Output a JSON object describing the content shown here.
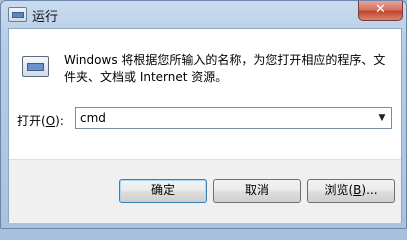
{
  "window": {
    "title": "运行",
    "close_label": "✕"
  },
  "dialog": {
    "description": "Windows 将根据您所输入的名称，为您打开相应的程序、文件夹、文档或 Internet 资源。",
    "open_label_prefix": "打开(",
    "open_label_key": "O",
    "open_label_suffix": "):",
    "input_value": "cmd",
    "dropdown_arrow": "▼"
  },
  "buttons": {
    "ok": "确定",
    "cancel": "取消",
    "browse_prefix": "浏览(",
    "browse_key": "B",
    "browse_suffix": ")..."
  },
  "icons": {
    "app": "run-app-icon",
    "dialog": "run-program-icon"
  }
}
